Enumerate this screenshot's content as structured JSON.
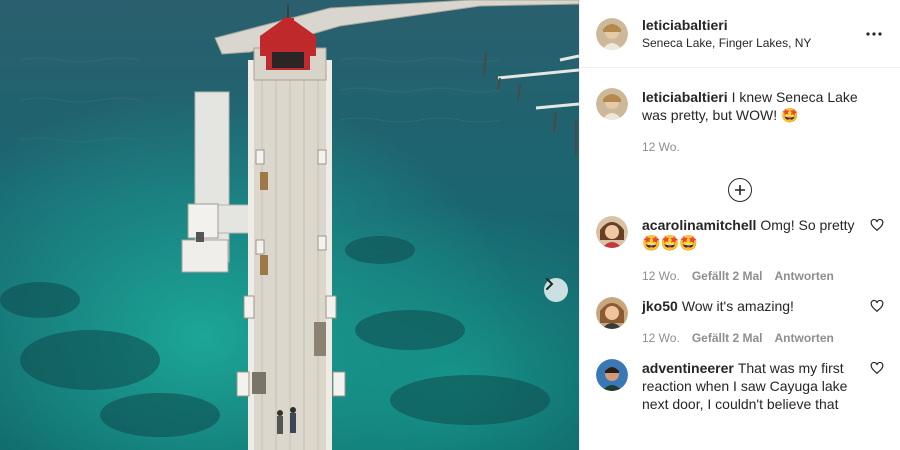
{
  "post": {
    "author": "leticiabaltieri",
    "location": "Seneca Lake, Finger Lakes, NY"
  },
  "caption": {
    "user": "leticiabaltieri",
    "text": "I knew Seneca Lake was pretty, but WOW! 🤩",
    "time": "12 Wo."
  },
  "comments": [
    {
      "user": "acarolinamitchell",
      "text": "Omg! So pretty",
      "emoji": "🤩🤩🤩",
      "time": "12 Wo.",
      "likes": "Gefällt 2 Mal",
      "reply": "Antworten"
    },
    {
      "user": "jko50",
      "text": "Wow it's amazing!",
      "time": "12 Wo.",
      "likes": "Gefällt 2 Mal",
      "reply": "Antworten"
    },
    {
      "user": "adventineerer",
      "text": "That was my first reaction when I saw Cayuga lake next door, I couldn't believe that"
    }
  ],
  "icons": {
    "more": "more-options-icon",
    "load_more": "plus-circle-icon",
    "like": "heart-icon",
    "next": "chevron-right-icon"
  },
  "colors": {
    "water": "#1a6570",
    "shallow": "#16a89a",
    "roof": "#c0292c"
  }
}
